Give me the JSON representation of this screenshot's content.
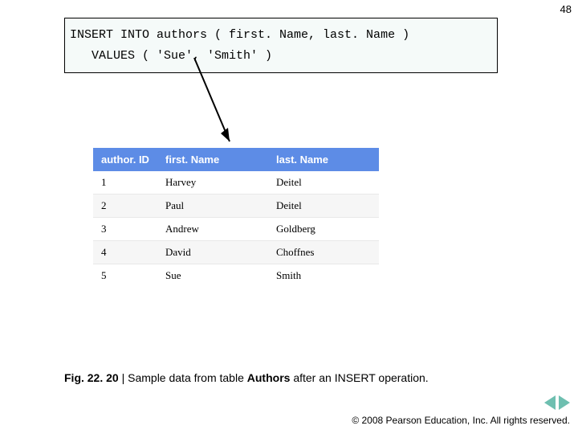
{
  "pageNumber": "48",
  "code": {
    "line1": "INSERT INTO authors ( first. Name, last. Name )",
    "line2": "   VALUES ( 'Sue', 'Smith' )"
  },
  "table": {
    "headers": {
      "id": "author. ID",
      "first": "first. Name",
      "last": "last. Name"
    },
    "rows": [
      {
        "id": "1",
        "first": "Harvey",
        "last": "Deitel"
      },
      {
        "id": "2",
        "first": "Paul",
        "last": "Deitel"
      },
      {
        "id": "3",
        "first": "Andrew",
        "last": "Goldberg"
      },
      {
        "id": "4",
        "first": "David",
        "last": "Choffnes"
      },
      {
        "id": "5",
        "first": "Sue",
        "last": "Smith"
      }
    ]
  },
  "caption": {
    "figLabel": "Fig. 22. 20",
    "sep": " | ",
    "pre": "Sample data from table ",
    "bold": "Authors",
    "post": " after an INSERT operation."
  },
  "copyright": "© 2008 Pearson Education, Inc.  All rights reserved."
}
